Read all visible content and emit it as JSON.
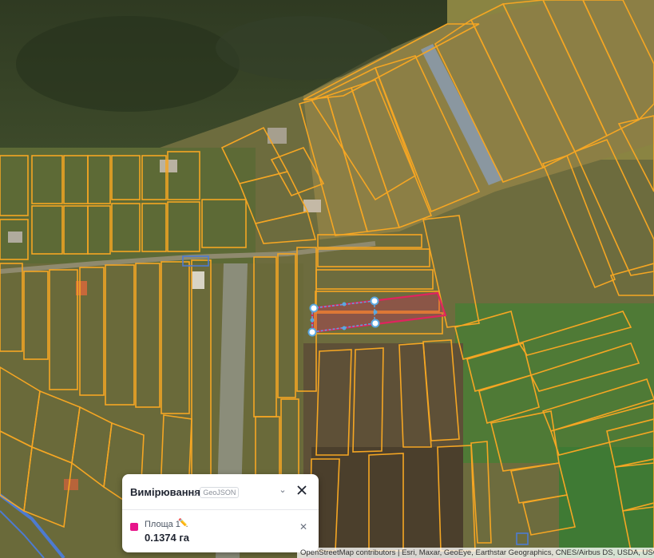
{
  "map": {
    "type": "satellite-cadastral",
    "parcel_outline_color": "#f5a623",
    "road_color": "#4d7bd1",
    "measure_polygon_color": "#e0245e",
    "vertex_handle_color": "#5aa7e0"
  },
  "panel": {
    "title": "Вимірювання",
    "export_label": "GeoJSON",
    "export_icon": "download-icon",
    "collapse_icon": "chevron-down-icon",
    "close_icon": "close-icon",
    "measurement": {
      "name": "Площа 1",
      "edit_icon": "pencil-icon",
      "value": "0.1374 га",
      "color": "#e7148a",
      "remove_icon": "close-icon"
    }
  },
  "attribution": "OpenStreetMap contributors | Esri, Maxar, GeoEye, Earthstar Geographics, CNES/Airbus DS, USDA, USGS"
}
